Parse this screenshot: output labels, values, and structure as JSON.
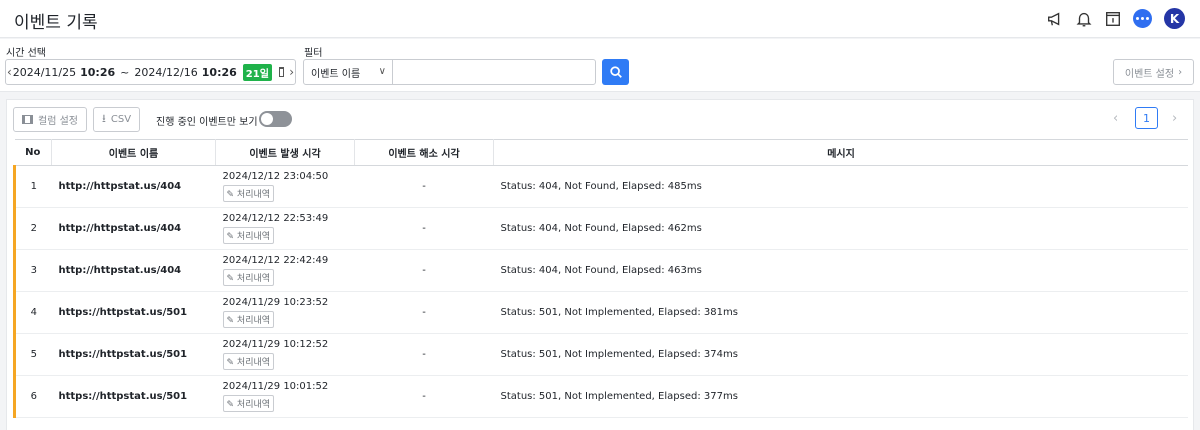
{
  "header": {
    "title": "이벤트 기록",
    "avatar_letter": "K",
    "icons": [
      "megaphone-icon",
      "bell-icon",
      "document-icon",
      "chat-icon"
    ]
  },
  "filters": {
    "time_label": "시간 선택",
    "start_date": "2024/11/25",
    "start_time": "10:26",
    "separator": "~",
    "end_date": "2024/12/16",
    "end_time": "10:26",
    "days_badge": "21일",
    "filter_label": "필터",
    "filter_select": "이벤트 이름",
    "filter_value": "",
    "settings_button": "이벤트 설정"
  },
  "toolbar": {
    "columns_button": "컬럼 설정",
    "csv_button": "CSV",
    "toggle_label": "진행 중인 이벤트만 보기",
    "current_page": "1"
  },
  "table": {
    "headers": [
      "No",
      "이벤트 이름",
      "이벤트 발생 시각",
      "이벤트 해소 시각",
      "메시지"
    ],
    "history_label": "처리내역",
    "rows": [
      {
        "no": "1",
        "name": "http://httpstat.us/404",
        "time": "2024/12/12 23:04:50",
        "resolved": "-",
        "message": "Status: 404, Not Found, Elapsed: 485ms"
      },
      {
        "no": "2",
        "name": "http://httpstat.us/404",
        "time": "2024/12/12 22:53:49",
        "resolved": "-",
        "message": "Status: 404, Not Found, Elapsed: 462ms"
      },
      {
        "no": "3",
        "name": "http://httpstat.us/404",
        "time": "2024/12/12 22:42:49",
        "resolved": "-",
        "message": "Status: 404, Not Found, Elapsed: 463ms"
      },
      {
        "no": "4",
        "name": "https://httpstat.us/501",
        "time": "2024/11/29 10:23:52",
        "resolved": "-",
        "message": "Status: 501, Not Implemented, Elapsed: 381ms"
      },
      {
        "no": "5",
        "name": "https://httpstat.us/501",
        "time": "2024/11/29 10:12:52",
        "resolved": "-",
        "message": "Status: 501, Not Implemented, Elapsed: 374ms"
      },
      {
        "no": "6",
        "name": "https://httpstat.us/501",
        "time": "2024/11/29 10:01:52",
        "resolved": "-",
        "message": "Status: 501, Not Implemented, Elapsed: 377ms"
      }
    ]
  },
  "colors": {
    "accent": "#2f7bf5",
    "row_marker": "#f5a623",
    "days_badge": "#1fb24a",
    "avatar": "#2536a6"
  }
}
